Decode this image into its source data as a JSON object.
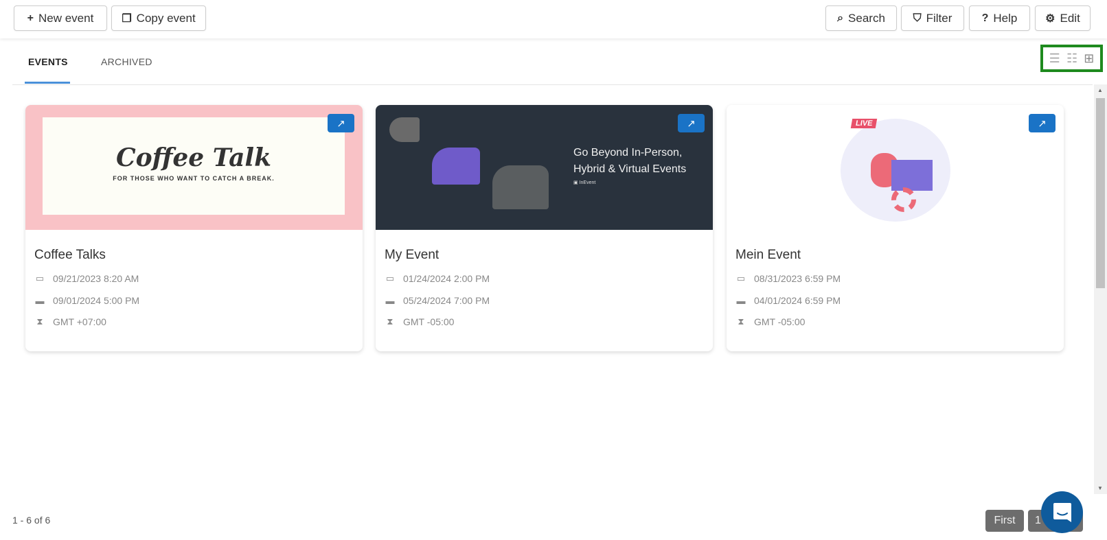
{
  "toolbar": {
    "new_event": "New event",
    "copy_event": "Copy event",
    "search": "Search",
    "filter": "Filter",
    "help": "Help",
    "edit": "Edit"
  },
  "tabs": [
    {
      "label": "EVENTS",
      "active": true
    },
    {
      "label": "ARCHIVED",
      "active": false
    }
  ],
  "view_switcher": {
    "options": [
      "list-view",
      "detailed-list-view",
      "grid-view"
    ],
    "selected": "grid-view",
    "highlight_color": "#1e8a1e"
  },
  "events": [
    {
      "title": "Coffee Talks",
      "start": "09/21/2023 8:20 AM",
      "end": "09/01/2024 5:00 PM",
      "timezone": "GMT +07:00",
      "banner": {
        "headline": "Coffee Talk",
        "tagline": "FOR THOSE WHO WANT TO CATCH A BREAK."
      }
    },
    {
      "title": "My Event",
      "start": "01/24/2024 2:00 PM",
      "end": "05/24/2024 7:00 PM",
      "timezone": "GMT -05:00",
      "banner": {
        "headline": "Go Beyond In-Person, Hybrid  & Virtual Events",
        "logo": "InEvent"
      }
    },
    {
      "title": "Mein Event",
      "start": "08/31/2023 6:59 PM",
      "end": "04/01/2024 6:59 PM",
      "timezone": "GMT -05:00",
      "banner": {
        "badge": "LIVE"
      }
    }
  ],
  "footer": {
    "range": "1 - 6 of 6"
  },
  "pagination": {
    "first": "First",
    "current": "1"
  },
  "colors": {
    "accent": "#1a73c6",
    "tab_underline": "#4a90d9",
    "chat": "#0f5b9c"
  }
}
